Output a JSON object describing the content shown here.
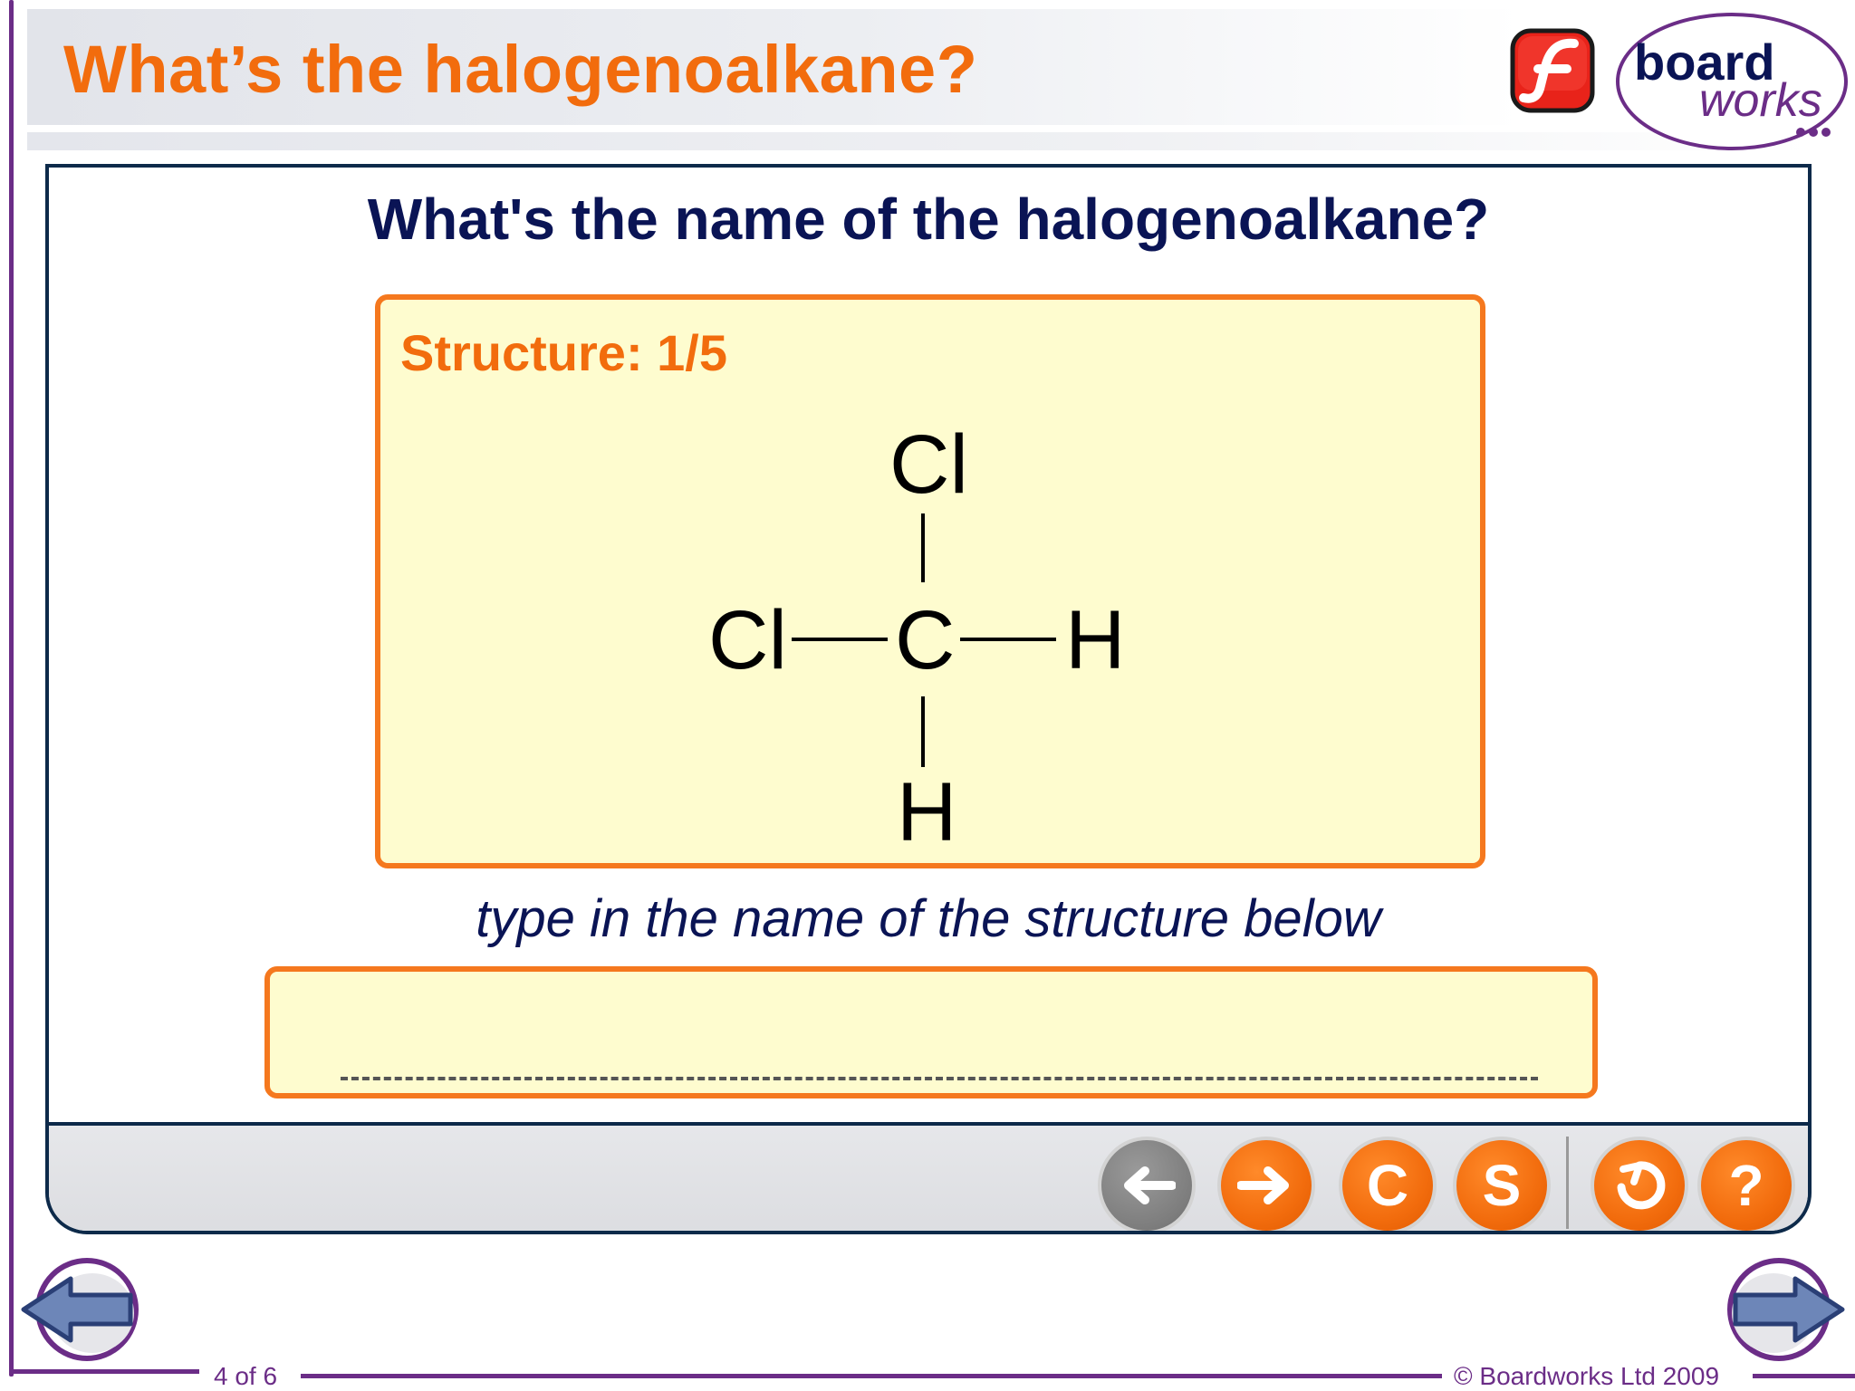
{
  "header": {
    "title": "What’s the halogenoalkane?",
    "flash_logo_icon": "flash-logo-icon",
    "boardworks_logo": {
      "line1": "board",
      "line2": "works"
    }
  },
  "panel": {
    "question": "What's the name of the halogenoalkane?",
    "structure": {
      "label_prefix": "Structure:",
      "index": "1/5",
      "atoms": {
        "top": "Cl",
        "left": "Cl",
        "center": "C",
        "right": "H",
        "bottom": "H"
      }
    },
    "instruction": "type in the name of the structure below",
    "answer": {
      "value": "",
      "placeholder": ""
    }
  },
  "toolbar": {
    "buttons": [
      {
        "name": "back-button",
        "icon": "left-arrow-icon",
        "color": "#7d7d7d"
      },
      {
        "name": "forward-button",
        "icon": "right-arrow-icon",
        "color": "#f26c0d"
      },
      {
        "name": "c-button",
        "label": "C",
        "color": "#f26c0d"
      },
      {
        "name": "s-button",
        "label": "S",
        "color": "#f26c0d"
      },
      {
        "name": "reset-button",
        "icon": "reset-icon",
        "color": "#f26c0d"
      },
      {
        "name": "help-button",
        "label": "?",
        "color": "#f26c0d"
      }
    ]
  },
  "footer": {
    "page_counter": "4 of 6",
    "copyright": "© Boardworks Ltd 2009"
  },
  "colors": {
    "accent": "#f26c0d",
    "navy": "#0a1455",
    "frame": "#6b2d87",
    "box_fill": "#fefccf"
  }
}
